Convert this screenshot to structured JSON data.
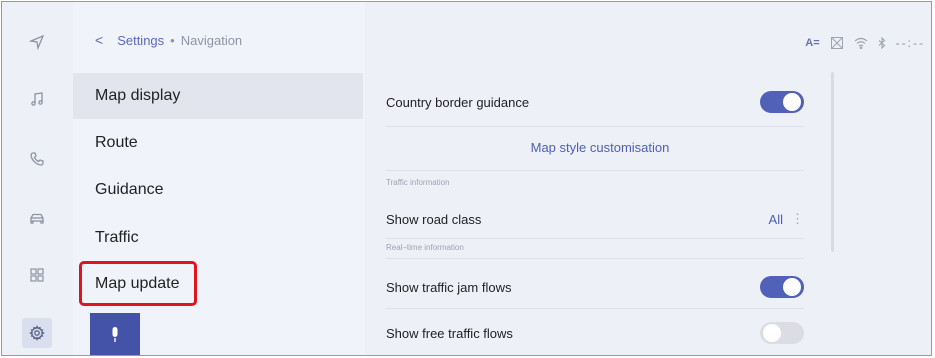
{
  "breadcrumb": {
    "back": "<",
    "parent": "Settings",
    "separator": "•",
    "current": "Navigation"
  },
  "rail": [
    {
      "icon": "navigation-arrow-icon"
    },
    {
      "icon": "music-note-icon"
    },
    {
      "icon": "phone-icon"
    },
    {
      "icon": "car-icon"
    },
    {
      "icon": "apps-grid-icon"
    },
    {
      "icon": "settings-gear-icon",
      "active": true
    }
  ],
  "menu": {
    "items": [
      {
        "label": "Map display",
        "selected": true
      },
      {
        "label": "Route"
      },
      {
        "label": "Guidance"
      },
      {
        "label": "Traffic"
      },
      {
        "label": "Map update",
        "highlighted": true
      }
    ]
  },
  "status": {
    "text_size_icon": "A=",
    "clock": "--:--"
  },
  "content": {
    "country_border": {
      "label": "Country border guidance",
      "on": true
    },
    "map_style_link": "Map style customisation",
    "traffic_section": "Traffic information",
    "road_class": {
      "label": "Show road class",
      "value": "All",
      "more": "⋮"
    },
    "realtime_section": "Real–time information",
    "traffic_jam": {
      "label": "Show traffic jam flows",
      "on": true
    },
    "free_traffic": {
      "label": "Show free traffic flows",
      "on": false
    }
  },
  "colors": {
    "accent": "#5261b8",
    "highlight": "#e0141d",
    "mic": "#4452a8"
  }
}
